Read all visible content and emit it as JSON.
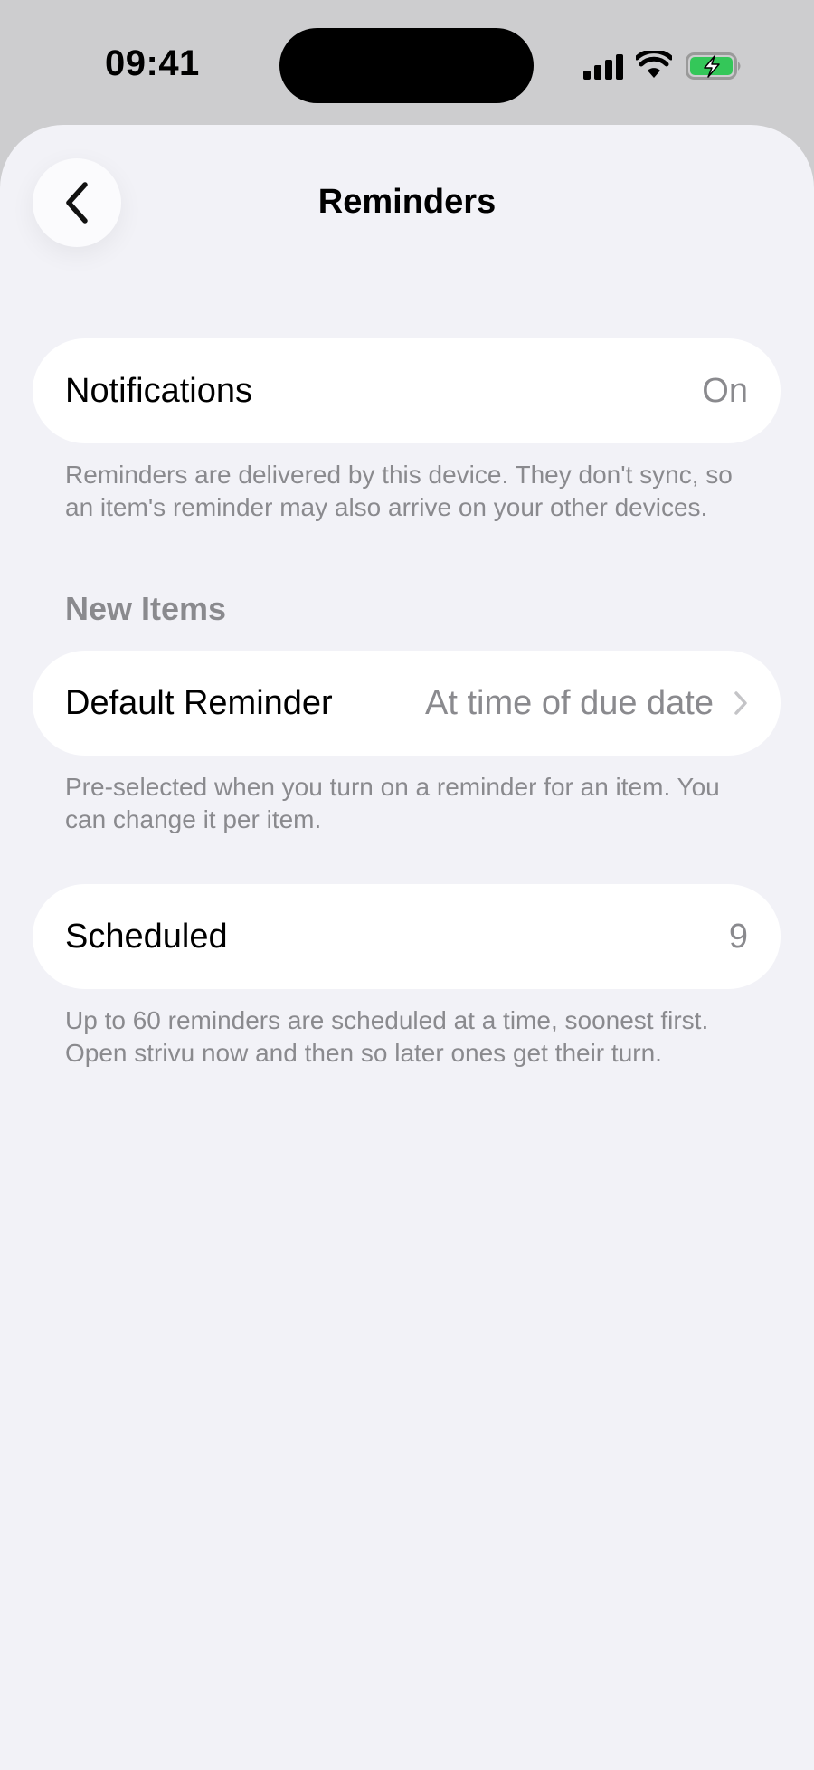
{
  "status_bar": {
    "time": "09:41"
  },
  "header": {
    "title": "Reminders"
  },
  "notifications": {
    "label": "Notifications",
    "value": "On"
  },
  "notifications_footnote": "Reminders are delivered by this device. They don't sync, so an item's reminder may also arrive on your other devices.",
  "new_items": {
    "header": "New Items",
    "default_reminder": {
      "label": "Default Reminder",
      "value": "At time of due date"
    },
    "footnote": "Pre-selected when you turn on a reminder for an item. You can change it per item."
  },
  "scheduled": {
    "label": "Scheduled",
    "value": "9"
  },
  "scheduled_footnote": "Up to 60 reminders are scheduled at a time, soonest first. Open strivu now and then so later ones get their turn.",
  "colors": {
    "accent_battery": "#34c759",
    "secondary_text": "#8a8a8e",
    "background": "#f2f2f7"
  }
}
